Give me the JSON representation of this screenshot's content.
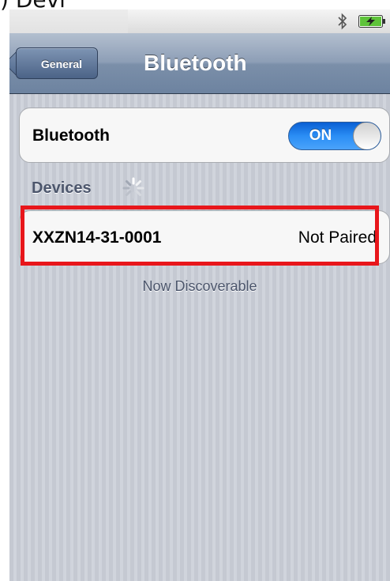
{
  "caption": ") Devi",
  "nav": {
    "back_label": "General",
    "title": "Bluetooth"
  },
  "bluetooth": {
    "label": "Bluetooth",
    "toggle_label": "ON",
    "toggle_state": "on"
  },
  "devices": {
    "header": "Devices",
    "items": [
      {
        "name": "XXZN14-31-0001",
        "status": "Not Paired"
      }
    ],
    "footer": "Now Discoverable"
  },
  "colors": {
    "highlight": "#e8161b",
    "toggle_on": "#2b8ef5",
    "navbar": "#7b8fa9"
  },
  "icons": [
    "bluetooth-status-icon",
    "battery-charging-icon",
    "loading-spinner-icon",
    "back-chevron-icon"
  ]
}
